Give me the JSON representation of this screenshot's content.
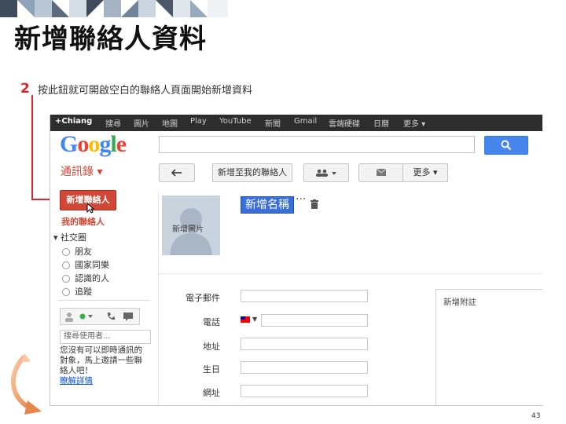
{
  "slide": {
    "title": "新增聯絡人資料",
    "step_number": "2",
    "step_text": "按此鈕就可開啟空白的聯絡人頁面開始新增資料",
    "page_number": "43"
  },
  "gbar": {
    "items": [
      "+Chiang",
      "搜尋",
      "圖片",
      "地圖",
      "Play",
      "YouTube",
      "新聞",
      "Gmail",
      "雲端硬碟",
      "日曆",
      "更多 ▾"
    ]
  },
  "logo": {
    "text": "Google"
  },
  "colors": {
    "accent_red": "#d14836",
    "google_blue": "#4285f4",
    "google_red": "#ea4335",
    "google_yellow": "#fbbc05",
    "google_green": "#34a853",
    "gbar_bg": "#2d2d2d"
  },
  "toolbar": {
    "contacts_menu": "通訊錄 ▾",
    "back_icon": "arrow-left-icon",
    "add_to_my_contacts": "新增至我的聯絡人",
    "group_icon": "people-icon",
    "email_icon": "envelope-icon",
    "more": "更多 ▾"
  },
  "sidebar": {
    "new_contact": "新增聯絡人",
    "my_contacts": "我的聯絡人",
    "circles": "▾ 社交圈",
    "circle_items": [
      "朋友",
      "國家同樂",
      "認識的人",
      "追蹤"
    ]
  },
  "chat": {
    "search_placeholder": "搜尋使用者...",
    "message": "您沒有可以即時通訊的對象，馬上邀請一些聯絡人吧！",
    "learn_more": "瞭解詳情"
  },
  "contact": {
    "photo_label": "新增圖片",
    "name": "新增名稱",
    "more_dots": "···",
    "fields": [
      "電子郵件",
      "電話",
      "地址",
      "生日",
      "網址"
    ],
    "notes_label": "新增附註"
  }
}
